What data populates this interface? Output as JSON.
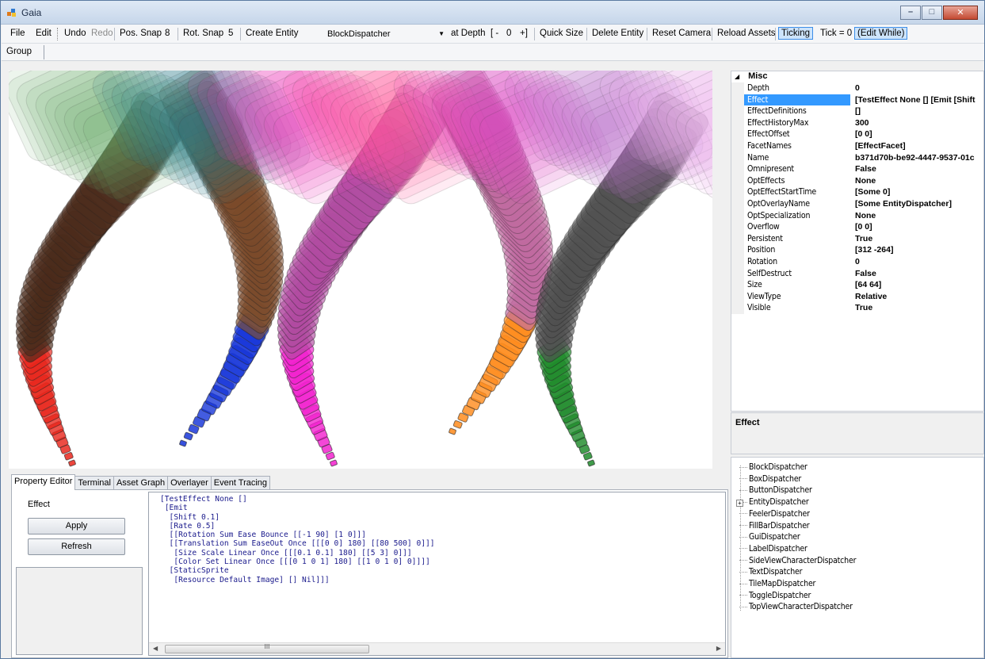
{
  "window": {
    "title": "Gaia"
  },
  "menubar": {
    "file": "File",
    "edit": "Edit",
    "undo": "Undo",
    "redo": "Redo",
    "pos_snap": "Pos. Snap",
    "pos_snap_value": "8",
    "rot_snap": "Rot. Snap",
    "rot_snap_value": "5",
    "create_entity": "Create Entity",
    "entity_type": "BlockDispatcher",
    "at_depth": "at Depth",
    "depth_minus": "[ -",
    "depth_value": "0",
    "depth_plus": "+]",
    "quick_size": "Quick Size",
    "delete_entity": "Delete Entity",
    "reset_camera": "Reset Camera",
    "reload_assets": "Reload Assets",
    "ticking": "Ticking",
    "tick": "Tick = 0",
    "edit_while": "(Edit While)"
  },
  "toolbar2": {
    "group": "Group"
  },
  "properties": {
    "category": "Misc",
    "rows": [
      {
        "name": "Depth",
        "value": "0"
      },
      {
        "name": "Effect",
        "value": "[TestEffect None [] [Emit [Shift"
      },
      {
        "name": "EffectDefinitions",
        "value": "[]"
      },
      {
        "name": "EffectHistoryMax",
        "value": "300"
      },
      {
        "name": "EffectOffset",
        "value": "[0 0]"
      },
      {
        "name": "FacetNames",
        "value": "[EffectFacet]"
      },
      {
        "name": "Name",
        "value": "b371d70b-be92-4447-9537-01c"
      },
      {
        "name": "Omnipresent",
        "value": "False"
      },
      {
        "name": "OptEffects",
        "value": "None"
      },
      {
        "name": "OptEffectStartTime",
        "value": "[Some 0]"
      },
      {
        "name": "OptOverlayName",
        "value": "[Some EntityDispatcher]"
      },
      {
        "name": "OptSpecialization",
        "value": "None"
      },
      {
        "name": "Overflow",
        "value": "[0 0]"
      },
      {
        "name": "Persistent",
        "value": "True"
      },
      {
        "name": "Position",
        "value": "[312 -264]"
      },
      {
        "name": "Rotation",
        "value": "0"
      },
      {
        "name": "SelfDestruct",
        "value": "False"
      },
      {
        "name": "Size",
        "value": "[64 64]"
      },
      {
        "name": "ViewType",
        "value": "Relative"
      },
      {
        "name": "Visible",
        "value": "True"
      }
    ],
    "selected_index": 1,
    "description_title": "Effect"
  },
  "tree": {
    "items": [
      "BlockDispatcher",
      "BoxDispatcher",
      "ButtonDispatcher",
      "EntityDispatcher",
      "FeelerDispatcher",
      "FillBarDispatcher",
      "GuiDispatcher",
      "LabelDispatcher",
      "SideViewCharacterDispatcher",
      "TextDispatcher",
      "TileMapDispatcher",
      "ToggleDispatcher",
      "TopViewCharacterDispatcher"
    ],
    "expandable_index": 3
  },
  "tabs": [
    "Property Editor",
    "Terminal",
    "Asset Graph",
    "Overlayer",
    "Event Tracing"
  ],
  "editor_panel": {
    "label": "Effect",
    "apply": "Apply",
    "refresh": "Refresh",
    "code_lines": [
      "[TestEffect None []",
      " [Emit",
      "  [Shift 0.1]",
      "  [Rate 0.5]",
      "  [[Rotation Sum Ease Bounce [[-1 90] [1 0]]]",
      "  [[Translation Sum EaseOut Once [[[0 0] 180] [[80 500] 0]]]",
      "   [Size Scale Linear Once [[[0.1 0.1] 180] [[5 3] 0]]]",
      "   [Color Set Linear Once [[[0 1 0 1] 180] [[1 0 1 0] 0]]]]",
      "  [StaticSprite",
      "   [Resource Default Image] [] Nil]]]"
    ],
    "scroll_thumb": "III"
  },
  "colors": {
    "selection": "#3399ff",
    "checked_bg": "#cde4fb",
    "ribbon_red": "#e8241a",
    "ribbon_blue": "#1433d8",
    "ribbon_magenta": "#f21fce",
    "ribbon_orange": "#ff8a1a",
    "ribbon_green": "#1e8a2a"
  }
}
